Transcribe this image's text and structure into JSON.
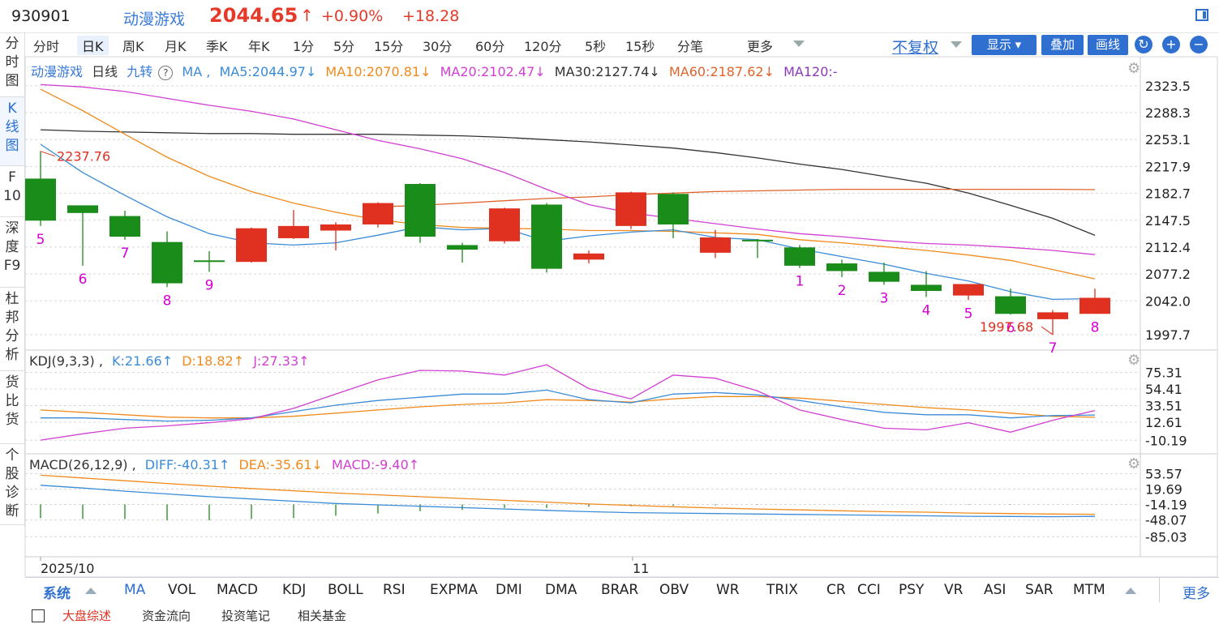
{
  "header": {
    "code": "930901",
    "name": "动漫游戏",
    "price": "2044.65",
    "arrow": "↑",
    "change_pct": "+0.90%",
    "change": "+18.28",
    "window_icon": "window-toggle-icon"
  },
  "leftnav": [
    {
      "label": "分时图",
      "lines": [
        "分",
        "时",
        "图"
      ]
    },
    {
      "label": "K线图",
      "lines": [
        "K",
        "线",
        "图"
      ]
    },
    {
      "label": "F10",
      "lines": [
        "F",
        "10"
      ]
    },
    {
      "label": "深度F9",
      "lines": [
        "深",
        "度",
        "F9"
      ]
    },
    {
      "label": "杜邦分析",
      "lines": [
        "杜",
        "邦",
        "分",
        "析"
      ]
    },
    {
      "label": "货比货",
      "lines": [
        "货",
        "比",
        "货"
      ]
    },
    {
      "label": "个股诊断",
      "lines": [
        "个",
        "股",
        "诊",
        "断"
      ]
    }
  ],
  "periods": [
    "分时",
    "日K",
    "周K",
    "月K",
    "季K",
    "年K",
    "1分",
    "5分",
    "15分",
    "30分",
    "60分",
    "120分",
    "5秒",
    "15秒",
    "分笔",
    "更多"
  ],
  "period_active": "日K",
  "toolbar": {
    "restore": "不复权",
    "show": "显示",
    "overlay": "叠加",
    "draw": "画线",
    "refresh_icon": "refresh-icon",
    "zoom_in_icon": "plus-icon",
    "zoom_out_icon": "minus-icon"
  },
  "main_legend": {
    "name": "动漫游戏",
    "period": "日线",
    "nine": "九转",
    "help": "?",
    "ma": "MA ,",
    "ma5": "MA5:2044.97↓",
    "ma10": "MA10:2070.81↓",
    "ma20": "MA20:2102.47↓",
    "ma30": "MA30:2127.74↓",
    "ma60": "MA60:2187.62↓",
    "ma120": "MA120:-"
  },
  "price_axis": [
    "2323.5",
    "2288.3",
    "2253.1",
    "2217.9",
    "2182.7",
    "2147.5",
    "2112.4",
    "2077.2",
    "2042.0",
    "1997.7"
  ],
  "max_label": "2237.76",
  "min_label": "1997.68",
  "kdj_legend": {
    "name": "KDJ(9,3,3) ,",
    "k": "K:21.66↑",
    "d": "D:18.82↑",
    "j": "J:27.33↑"
  },
  "kdj_axis": [
    "75.31",
    "54.41",
    "33.51",
    "12.61",
    "-10.19"
  ],
  "macd_legend": {
    "name": "MACD(26,12,9) ,",
    "diff": "DIFF:-40.31↑",
    "dea": "DEA:-35.61↓",
    "macd": "MACD:-9.40↑"
  },
  "macd_axis": [
    "53.57",
    "19.69",
    "-14.19",
    "-48.07",
    "-85.03"
  ],
  "date_axis": [
    "2025/10",
    "11"
  ],
  "indicator_tabs": {
    "system": "系统",
    "items": [
      "MA",
      "VOL",
      "MACD",
      "KDJ",
      "BOLL",
      "RSI",
      "EXPMA",
      "DMI",
      "DMA",
      "BRAR",
      "OBV",
      "WR",
      "TRIX",
      "CR",
      "CCI",
      "PSY",
      "VR",
      "ASI",
      "SAR",
      "MTM"
    ],
    "more": "更多"
  },
  "subtabs": [
    "大盘综述",
    "资金流向",
    "投资笔记",
    "相关基金"
  ],
  "colors": {
    "up": "#e03020",
    "down": "#1a8c1a",
    "ma5": "#3a8bd8",
    "ma10": "#f08a1c",
    "ma20": "#d23fd2",
    "ma30": "#333333",
    "ma60": "#e0642a",
    "nine": "#d400d4",
    "accent": "#2f6fd0"
  },
  "chart_data": {
    "type": "candlestick",
    "candles": [
      {
        "o": 2202,
        "c": 2147,
        "h": 2237.76,
        "l": 2140,
        "nine": "5"
      },
      {
        "o": 2167,
        "c": 2157,
        "h": 2167,
        "l": 2088,
        "nine": "6"
      },
      {
        "o": 2153,
        "c": 2126,
        "h": 2160,
        "l": 2122,
        "nine": "7"
      },
      {
        "o": 2119,
        "c": 2065,
        "h": 2133,
        "l": 2060,
        "nine": "8"
      },
      {
        "o": 2095,
        "c": 2093,
        "h": 2107,
        "l": 2080,
        "nine": "9"
      },
      {
        "o": 2093,
        "c": 2137,
        "h": 2138,
        "l": 2092,
        "nine": ""
      },
      {
        "o": 2124,
        "c": 2140,
        "h": 2161,
        "l": 2123,
        "nine": ""
      },
      {
        "o": 2134,
        "c": 2142,
        "h": 2145,
        "l": 2108,
        "nine": ""
      },
      {
        "o": 2142,
        "c": 2170,
        "h": 2171,
        "l": 2138,
        "nine": ""
      },
      {
        "o": 2195,
        "c": 2126,
        "h": 2196,
        "l": 2118,
        "nine": ""
      },
      {
        "o": 2115,
        "c": 2109,
        "h": 2118,
        "l": 2092,
        "nine": ""
      },
      {
        "o": 2120,
        "c": 2163,
        "h": 2164,
        "l": 2117,
        "nine": ""
      },
      {
        "o": 2168,
        "c": 2084,
        "h": 2170,
        "l": 2079,
        "nine": ""
      },
      {
        "o": 2096,
        "c": 2104,
        "h": 2108,
        "l": 2091,
        "nine": ""
      },
      {
        "o": 2140,
        "c": 2184,
        "h": 2185,
        "l": 2136,
        "nine": ""
      },
      {
        "o": 2182,
        "c": 2142,
        "h": 2184,
        "l": 2124,
        "nine": ""
      },
      {
        "o": 2105,
        "c": 2125,
        "h": 2135,
        "l": 2098,
        "nine": ""
      },
      {
        "o": 2122,
        "c": 2120,
        "h": 2123,
        "l": 2098,
        "nine": ""
      },
      {
        "o": 2112,
        "c": 2088,
        "h": 2115,
        "l": 2085,
        "nine": "1"
      },
      {
        "o": 2091,
        "c": 2081,
        "h": 2096,
        "l": 2073,
        "nine": "2"
      },
      {
        "o": 2080,
        "c": 2067,
        "h": 2092,
        "l": 2063,
        "nine": "3"
      },
      {
        "o": 2063,
        "c": 2055,
        "h": 2081,
        "l": 2047,
        "nine": "4"
      },
      {
        "o": 2049,
        "c": 2064,
        "h": 2064,
        "l": 2043,
        "nine": "5"
      },
      {
        "o": 2048,
        "c": 2025,
        "h": 2058,
        "l": 2024,
        "nine": "6"
      },
      {
        "o": 2018,
        "c": 2027,
        "h": 2030,
        "l": 1997.68,
        "nine": "7"
      },
      {
        "o": 2025,
        "c": 2046,
        "h": 2058,
        "l": 2025,
        "nine": "8"
      }
    ],
    "ma5": [
      2247,
      2210,
      2180,
      2152,
      2130,
      2118,
      2115,
      2118,
      2128,
      2139,
      2135,
      2137,
      2120,
      2127,
      2132,
      2135,
      2125,
      2122,
      2110,
      2100,
      2090,
      2078,
      2068,
      2054,
      2044,
      2044.97
    ],
    "ma10": [
      2319,
      2291,
      2260,
      2230,
      2205,
      2185,
      2170,
      2158,
      2148,
      2142,
      2138,
      2137,
      2136,
      2134,
      2134,
      2133,
      2131,
      2129,
      2122,
      2118,
      2113,
      2108,
      2102,
      2095,
      2083,
      2070.81
    ],
    "ma20": [
      2325,
      2322,
      2316,
      2307,
      2298,
      2290,
      2280,
      2266,
      2252,
      2241,
      2228,
      2210,
      2188,
      2168,
      2157,
      2150,
      2143,
      2136,
      2130,
      2126,
      2121,
      2117,
      2115,
      2112,
      2108,
      2102.47
    ],
    "ma30": [
      2266,
      2264,
      2263,
      2262,
      2261,
      2261,
      2260,
      2260,
      2260,
      2259,
      2258,
      2256,
      2253,
      2250,
      2246,
      2242,
      2236,
      2229,
      2221,
      2214,
      2205,
      2196,
      2183,
      2167,
      2150,
      2127.74
    ],
    "ma60": [
      null,
      null,
      null,
      null,
      null,
      null,
      null,
      null,
      2165,
      2167,
      2170,
      2173,
      2176,
      2178,
      2181,
      2183,
      2185,
      2186,
      2187,
      2188,
      2188,
      2188,
      2188,
      2188,
      2188,
      2187.62
    ],
    "kdj": {
      "k": [
        18,
        18,
        16,
        14,
        15,
        18,
        26,
        34,
        40,
        44,
        48,
        48,
        53,
        41,
        37,
        48,
        50,
        47,
        40,
        32,
        25,
        22,
        22,
        18,
        21,
        21.66
      ],
      "d": [
        28,
        25,
        22,
        19,
        18,
        18,
        20,
        24,
        28,
        32,
        35,
        37,
        41,
        40,
        38,
        42,
        45,
        45,
        43,
        39,
        35,
        31,
        28,
        24,
        20,
        18.82
      ],
      "j": [
        -10,
        -2,
        5,
        8,
        12,
        17,
        30,
        48,
        66,
        78,
        77,
        72,
        85,
        55,
        42,
        72,
        68,
        52,
        28,
        16,
        5,
        3,
        12,
        0,
        15,
        27.33
      ]
    },
    "macd": {
      "diff": [
        28,
        22,
        15,
        9,
        3,
        -2,
        -7,
        -12,
        -15,
        -18,
        -21,
        -24,
        -27,
        -30,
        -32,
        -33,
        -34,
        -35,
        -36,
        -37,
        -38,
        -39,
        -40,
        -40.5,
        -41,
        -40.31
      ],
      "dea": [
        50,
        44,
        38,
        32,
        26,
        21,
        16,
        11,
        7,
        3,
        -1,
        -5,
        -9,
        -13,
        -16,
        -19,
        -22,
        -24,
        -26,
        -28,
        -30,
        -31,
        -33,
        -34,
        -35,
        -35.61
      ],
      "hist": [
        -40,
        -42,
        -42,
        -45,
        -45,
        -42,
        -40,
        -35,
        -30,
        -25,
        -22,
        -18,
        -18,
        -15,
        -14,
        -13,
        -12,
        -11,
        -10,
        -10,
        -10,
        -10,
        -11,
        -11,
        -10,
        -9.4
      ]
    },
    "price_range": [
      1985,
      2335
    ],
    "kdj_range": [
      -15,
      80
    ],
    "macd_range": [
      -95,
      65
    ]
  }
}
